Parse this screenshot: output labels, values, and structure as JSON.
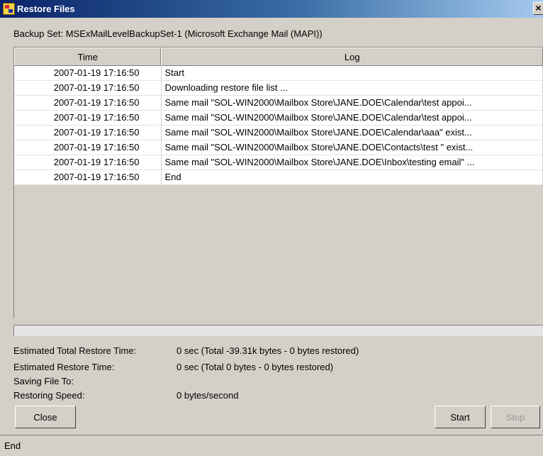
{
  "window": {
    "title": "Restore Files",
    "close_glyph": "×"
  },
  "backup_set": "Backup Set: MSExMailLevelBackupSet-1 (Microsoft Exchange Mail (MAPI))",
  "table": {
    "columns": [
      "Time",
      "Log"
    ],
    "rows": [
      {
        "time": "2007-01-19 17:16:50",
        "log": "Start"
      },
      {
        "time": "2007-01-19 17:16:50",
        "log": "Downloading restore file list ..."
      },
      {
        "time": "2007-01-19 17:16:50",
        "log": "Same mail \"SOL-WIN2000\\Mailbox Store\\JANE.DOE\\Calendar\\test appoi..."
      },
      {
        "time": "2007-01-19 17:16:50",
        "log": "Same mail \"SOL-WIN2000\\Mailbox Store\\JANE.DOE\\Calendar\\test appoi..."
      },
      {
        "time": "2007-01-19 17:16:50",
        "log": "Same mail \"SOL-WIN2000\\Mailbox Store\\JANE.DOE\\Calendar\\aaa\" exist..."
      },
      {
        "time": "2007-01-19 17:16:50",
        "log": "Same mail \"SOL-WIN2000\\Mailbox Store\\JANE.DOE\\Contacts\\test \" exist..."
      },
      {
        "time": "2007-01-19 17:16:50",
        "log": "Same mail \"SOL-WIN2000\\Mailbox Store\\JANE.DOE\\Inbox\\testing email\" ..."
      },
      {
        "time": "2007-01-19 17:16:50",
        "log": "End"
      }
    ]
  },
  "info": {
    "total_restore_time_label": "Estimated Total Restore Time:",
    "total_restore_time_value": "0 sec (Total -39.31k bytes - 0 bytes restored)",
    "restore_time_label": "Estimated Restore Time:",
    "restore_time_value": "0 sec (Total 0 bytes - 0 bytes restored)",
    "saving_file_label": "Saving File To:",
    "saving_file_value": "",
    "speed_label": "Restoring Speed:",
    "speed_value": "0 bytes/second"
  },
  "buttons": {
    "close": "Close",
    "start": "Start",
    "stop": "Stop"
  },
  "status": "End"
}
